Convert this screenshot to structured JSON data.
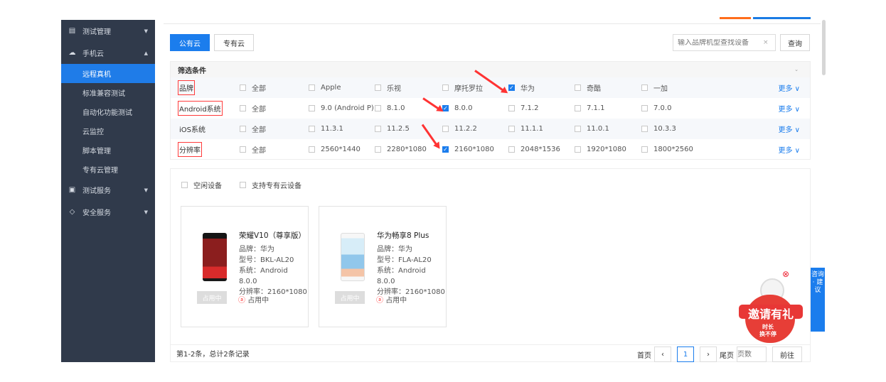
{
  "sidebar": {
    "groups": [
      {
        "label": "测试管理",
        "icon": "document-icon"
      },
      {
        "label": "手机云",
        "icon": "cloud-icon",
        "children": [
          "远程真机",
          "标准兼容测试",
          "自动化功能测试",
          "云监控",
          "脚本管理",
          "专有云管理"
        ],
        "active_child": "远程真机"
      },
      {
        "label": "测试服务",
        "icon": "terminal-icon"
      },
      {
        "label": "安全服务",
        "icon": "shield-icon"
      }
    ]
  },
  "tabs": {
    "public": "公有云",
    "private": "专有云"
  },
  "search": {
    "placeholder": "输入品牌机型查找设备",
    "clear": "×",
    "button": "查询"
  },
  "filters": {
    "title": "筛选条件",
    "collapse": "⌄",
    "rows": [
      {
        "label": "品牌",
        "options": [
          "全部",
          "Apple",
          "乐视",
          "摩托罗拉",
          "华为",
          "奇酷",
          "一加"
        ],
        "checked": [
          4
        ]
      },
      {
        "label": "Android系统",
        "options": [
          "全部",
          "9.0 (Android P)",
          "8.1.0",
          "8.0.0",
          "7.1.2",
          "7.1.1",
          "7.0.0"
        ],
        "checked": [
          3
        ]
      },
      {
        "label": "iOS系统",
        "options": [
          "全部",
          "11.3.1",
          "11.2.5",
          "11.2.2",
          "11.1.1",
          "11.0.1",
          "10.3.3"
        ],
        "checked": []
      },
      {
        "label": "分辨率",
        "options": [
          "全部",
          "2560*1440",
          "2280*1080",
          "2160*1080",
          "2048*1536",
          "1920*1080",
          "1800*2560"
        ],
        "checked": [
          3
        ]
      }
    ],
    "more": "更多 ∨"
  },
  "device_filters": {
    "idle": "空闲设备",
    "private_support": "支持专有云设备"
  },
  "devices": [
    {
      "name": "荣耀V10（尊享版）",
      "brand": "品牌：华为",
      "model": "型号：BKL-AL20",
      "system": "系统：Android 8.0.0",
      "resolution": "分辨率：2160*1080",
      "button": "占用中",
      "status": "占用中",
      "status_icon": "ⓐ"
    },
    {
      "name": "华为畅享8 Plus",
      "brand": "品牌：华为",
      "model": "型号：FLA-AL20",
      "system": "系统：Android 8.0.0",
      "resolution": "分辨率：2160*1080",
      "button": "占用中",
      "status": "占用中",
      "status_icon": "ⓐ"
    }
  ],
  "pagination": {
    "summary": "第1-2条，总计2条记录",
    "first": "首页",
    "prev": "‹",
    "current": "1",
    "next": "›",
    "last": "尾页",
    "page_placeholder": "页数",
    "go": "前往"
  },
  "promo": {
    "close": "⊗",
    "title": "邀请有礼",
    "line1": "时长",
    "line2": "换不停"
  },
  "help": {
    "label": "咨询 · 建议"
  }
}
